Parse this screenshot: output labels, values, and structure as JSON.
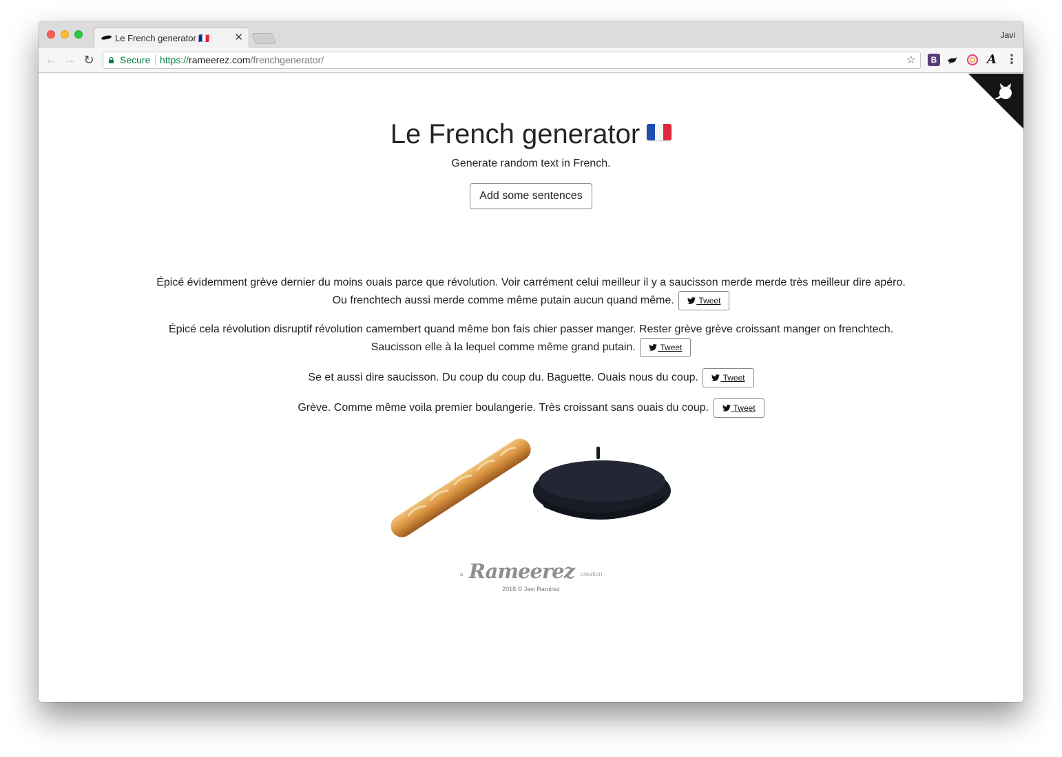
{
  "browser": {
    "tab_title": "Le French generator 🇫🇷",
    "profile_name": "Javi",
    "secure_label": "Secure",
    "url_scheme": "https://",
    "url_host": "rameerez.com",
    "url_path": "/frenchgenerator/",
    "extensions": [
      "bootstrap-icon",
      "bird-icon",
      "ring-icon",
      "font-icon"
    ]
  },
  "page": {
    "title": "Le French generator",
    "subtitle": "Generate random text in French.",
    "add_button_label": "Add some sentences",
    "tweet_label": "Tweet",
    "sentences": [
      {
        "text_lines": [
          "Épicé évidemment grève dernier du moins ouais parce que révolution. Voir carrément celui meilleur il y a saucisson merde merde très meilleur dire apéro.",
          "Ou frenchtech aussi merde comme même putain aucun quand même."
        ]
      },
      {
        "text_lines": [
          "Épicé cela révolution disruptif révolution camembert quand même bon fais chier passer manger. Rester grève grève croissant manger on frenchtech.",
          "Saucisson elle à la lequel comme même grand putain."
        ]
      },
      {
        "text_lines": [
          "Se et aussi dire saucisson. Du coup du coup du. Baguette. Ouais nous du coup."
        ]
      },
      {
        "text_lines": [
          "Grève. Comme même voila premier boulangerie. Très croissant sans ouais du coup."
        ]
      }
    ],
    "footer": {
      "prefix": "a",
      "brand": "Rameerez",
      "suffix": "creation",
      "copyright": "2018 © Javi Ramirez"
    }
  },
  "colors": {
    "secure_green": "#0b8043",
    "text": "#212529",
    "bootstrap_purple": "#563d7c"
  }
}
